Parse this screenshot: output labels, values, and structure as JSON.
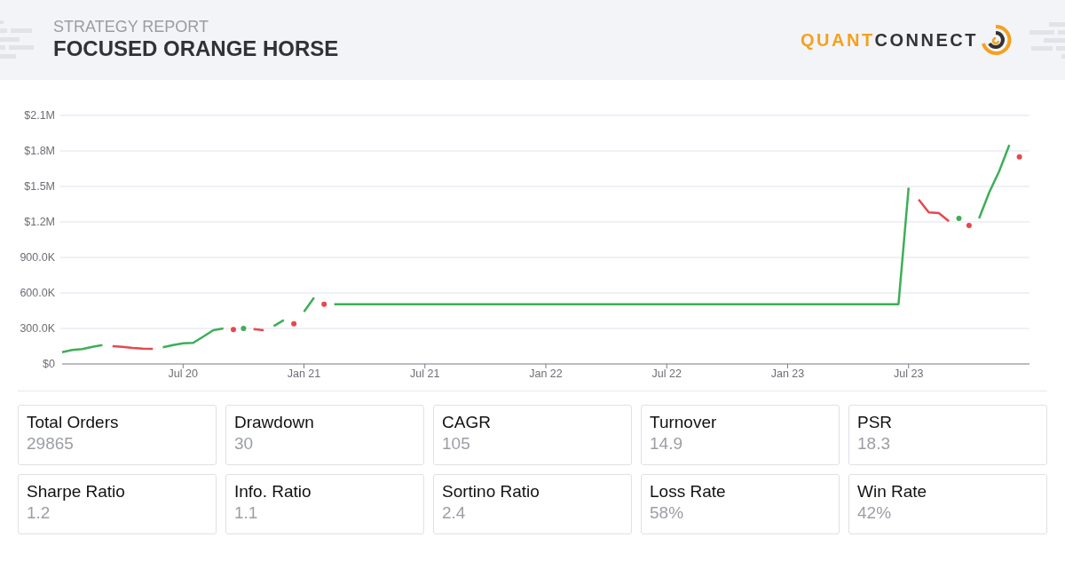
{
  "header": {
    "subtitle": "STRATEGY REPORT",
    "title": "FOCUSED ORANGE HORSE",
    "logo": {
      "part_1": "QUANT",
      "part_2": "CONNECT"
    }
  },
  "equity_chart": {
    "chart_data": {
      "type": "line",
      "grid": true,
      "categories": [
        null,
        null,
        null,
        null,
        null,
        null,
        null,
        null,
        null,
        null,
        null,
        null,
        "Jul 20",
        null,
        null,
        null,
        null,
        null,
        null,
        null,
        null,
        null,
        null,
        null,
        "Jan 21",
        null,
        null,
        null,
        null,
        null,
        null,
        null,
        null,
        null,
        null,
        null,
        "Jul 21",
        null,
        null,
        null,
        null,
        null,
        null,
        null,
        null,
        null,
        null,
        null,
        "Jan 22",
        null,
        null,
        null,
        null,
        null,
        null,
        null,
        null,
        null,
        null,
        null,
        "Jul 22",
        null,
        null,
        null,
        null,
        null,
        null,
        null,
        null,
        null,
        null,
        null,
        "Jan 23",
        null,
        null,
        null,
        null,
        null,
        null,
        null,
        null,
        null,
        null,
        null,
        "Jul 23",
        null,
        null,
        null,
        null,
        null,
        null,
        null,
        null,
        null,
        null,
        null
      ],
      "series": [
        {
          "color": "#3daf57",
          "values": [
            100000,
            118000,
            125000,
            145000,
            160000,
            null,
            null,
            null,
            null,
            null,
            140000,
            160000,
            175000,
            178000,
            230000,
            285000,
            300000,
            null,
            300000,
            null,
            null,
            320000,
            370000,
            null,
            440000,
            560000,
            null,
            505000,
            505000,
            505000,
            505000,
            505000,
            505000,
            505000,
            505000,
            505000,
            505000,
            505000,
            505000,
            505000,
            505000,
            505000,
            505000,
            505000,
            505000,
            505000,
            505000,
            505000,
            505000,
            505000,
            505000,
            505000,
            505000,
            505000,
            505000,
            505000,
            505000,
            505000,
            505000,
            505000,
            505000,
            505000,
            505000,
            505000,
            505000,
            505000,
            505000,
            505000,
            505000,
            505000,
            505000,
            505000,
            505000,
            505000,
            505000,
            505000,
            505000,
            505000,
            505000,
            505000,
            505000,
            505000,
            505000,
            505000,
            1490000,
            null,
            null,
            null,
            null,
            1230000,
            null,
            1230000,
            1450000,
            1630000,
            1850000,
            null
          ]
        },
        {
          "color": "#e5484d",
          "values": [
            null,
            null,
            null,
            null,
            null,
            150000,
            145000,
            135000,
            130000,
            128000,
            null,
            null,
            null,
            null,
            null,
            null,
            null,
            290000,
            null,
            295000,
            285000,
            null,
            null,
            340000,
            null,
            null,
            505000,
            null,
            null,
            null,
            null,
            null,
            null,
            null,
            null,
            null,
            null,
            null,
            null,
            null,
            null,
            null,
            null,
            null,
            null,
            null,
            null,
            null,
            null,
            null,
            null,
            null,
            null,
            null,
            null,
            null,
            null,
            null,
            null,
            null,
            null,
            null,
            null,
            null,
            null,
            null,
            null,
            null,
            null,
            null,
            null,
            null,
            null,
            null,
            null,
            null,
            null,
            null,
            null,
            null,
            null,
            null,
            null,
            null,
            null,
            1390000,
            1280000,
            1275000,
            1205000,
            null,
            1170000,
            null,
            null,
            null,
            null,
            1750000
          ]
        }
      ],
      "ylim": [
        0,
        2100000
      ],
      "yticks": [
        {
          "value": 0,
          "label": "$0"
        },
        {
          "value": 300000,
          "label": "300.0K"
        },
        {
          "value": 600000,
          "label": "600.0K"
        },
        {
          "value": 900000,
          "label": "900.0K"
        },
        {
          "value": 1200000,
          "label": "$1.2M"
        },
        {
          "value": 1500000,
          "label": "$1.5M"
        },
        {
          "value": 1800000,
          "label": "$1.8M"
        },
        {
          "value": 2100000,
          "label": "$2.1M"
        }
      ]
    }
  },
  "metrics": [
    {
      "label": "Total Orders",
      "value": "29865"
    },
    {
      "label": "Drawdown",
      "value": "30"
    },
    {
      "label": "CAGR",
      "value": "105"
    },
    {
      "label": "Turnover",
      "value": "14.9"
    },
    {
      "label": "PSR",
      "value": "18.3"
    },
    {
      "label": "Sharpe Ratio",
      "value": "1.2"
    },
    {
      "label": "Info. Ratio",
      "value": "1.1"
    },
    {
      "label": "Sortino Ratio",
      "value": "2.4"
    },
    {
      "label": "Loss Rate",
      "value": "58%"
    },
    {
      "label": "Win Rate",
      "value": "42%"
    }
  ]
}
